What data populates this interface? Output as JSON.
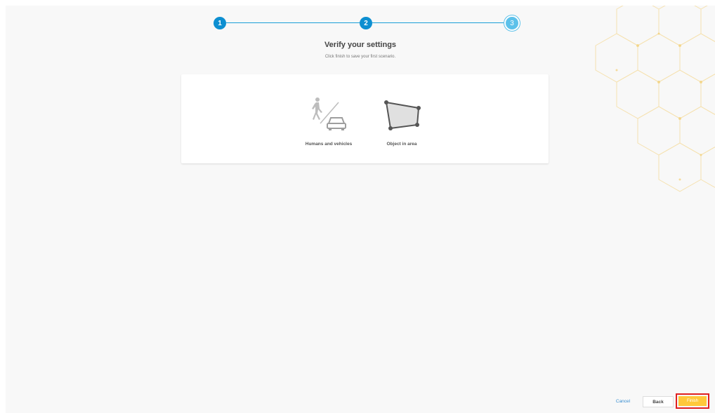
{
  "stepper": {
    "steps": [
      {
        "number": "1",
        "state": "completed"
      },
      {
        "number": "2",
        "state": "completed"
      },
      {
        "number": "3",
        "state": "current"
      }
    ]
  },
  "header": {
    "title": "Verify your settings",
    "subtitle": "Click finish to save your first scenario."
  },
  "summary": {
    "items": [
      {
        "label": "Humans and vehicles",
        "icon": "human-vehicle-icon"
      },
      {
        "label": "Object in area",
        "icon": "polygon-area-icon"
      }
    ]
  },
  "footer": {
    "cancel_label": "Cancel",
    "back_label": "Back",
    "finish_label": "Finish"
  },
  "colors": {
    "accent": "#0d8fd1",
    "finish": "#ffc83a",
    "highlight": "#e02020"
  }
}
